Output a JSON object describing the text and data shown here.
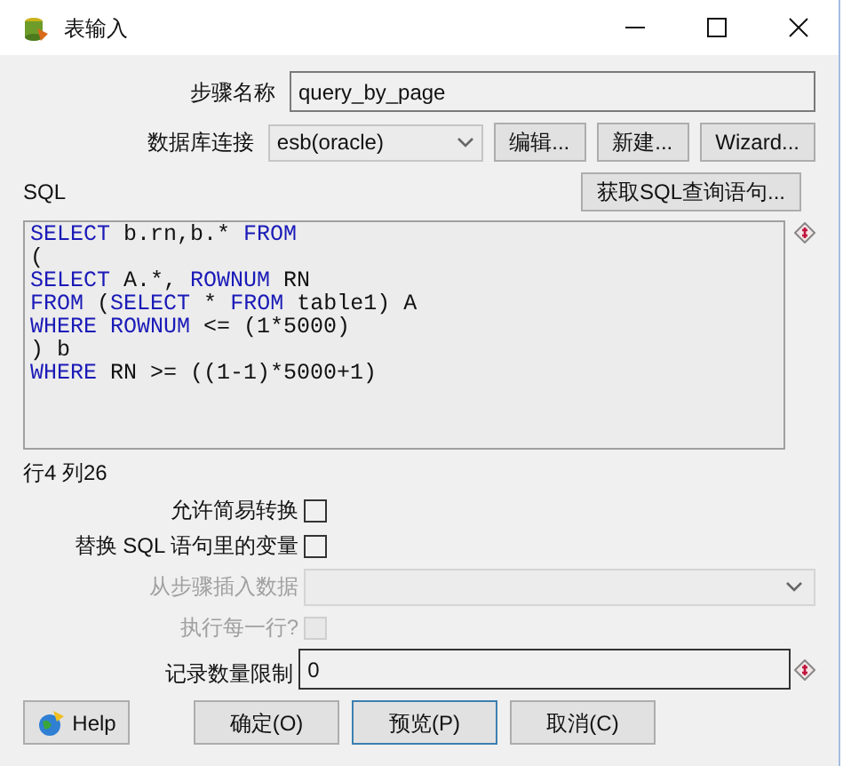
{
  "window": {
    "title": "表输入"
  },
  "step_name": {
    "label": "步骤名称",
    "value": "query_by_page"
  },
  "connection": {
    "label": "数据库连接",
    "value": "esb(oracle)",
    "buttons": [
      "编辑...",
      "新建...",
      "Wizard..."
    ]
  },
  "sql": {
    "label": "SQL",
    "get_button": "获取SQL查询语句...",
    "lines": [
      [
        {
          "kind": "keyword",
          "text": "SELECT"
        },
        {
          "kind": "plain",
          "text": " b.rn,b.* "
        },
        {
          "kind": "keyword",
          "text": "FROM"
        }
      ],
      [
        {
          "kind": "plain",
          "text": "("
        }
      ],
      [
        {
          "kind": "keyword",
          "text": "SELECT"
        },
        {
          "kind": "plain",
          "text": " A.*, "
        },
        {
          "kind": "keyword",
          "text": "ROWNUM"
        },
        {
          "kind": "plain",
          "text": " RN"
        }
      ],
      [
        {
          "kind": "keyword",
          "text": "FROM"
        },
        {
          "kind": "plain",
          "text": " ("
        },
        {
          "kind": "keyword",
          "text": "SELECT"
        },
        {
          "kind": "plain",
          "text": " * "
        },
        {
          "kind": "keyword",
          "text": "FROM"
        },
        {
          "kind": "plain",
          "text": " table1) A"
        }
      ],
      [
        {
          "kind": "keyword",
          "text": "WHERE ROWNUM"
        },
        {
          "kind": "plain",
          "text": " <= (1*5000)"
        }
      ],
      [
        {
          "kind": "plain",
          "text": ") b"
        }
      ],
      [
        {
          "kind": "keyword",
          "text": "WHERE"
        },
        {
          "kind": "plain",
          "text": " RN >= ((1-1)*5000+1)"
        }
      ]
    ],
    "position": "行4 列26"
  },
  "options": [
    {
      "kind": "checkbox",
      "label": "允许简易转换",
      "checked": false,
      "disabled": false
    },
    {
      "kind": "checkbox",
      "label": "替换 SQL 语句里的变量",
      "checked": false,
      "disabled": false
    },
    {
      "kind": "select",
      "label": "从步骤插入数据",
      "disabled": true
    },
    {
      "kind": "checkbox",
      "label": "执行每一行?",
      "checked": false,
      "disabled": true
    }
  ],
  "limit": {
    "label": "记录数量限制",
    "value": "0"
  },
  "buttons": [
    {
      "label": "Help",
      "kind": "help",
      "selected": false
    },
    {
      "label": "确定(O)",
      "kind": "plain",
      "selected": false
    },
    {
      "label": "预览(P)",
      "kind": "plain",
      "selected": true
    },
    {
      "label": "取消(C)",
      "kind": "plain",
      "selected": false
    }
  ]
}
